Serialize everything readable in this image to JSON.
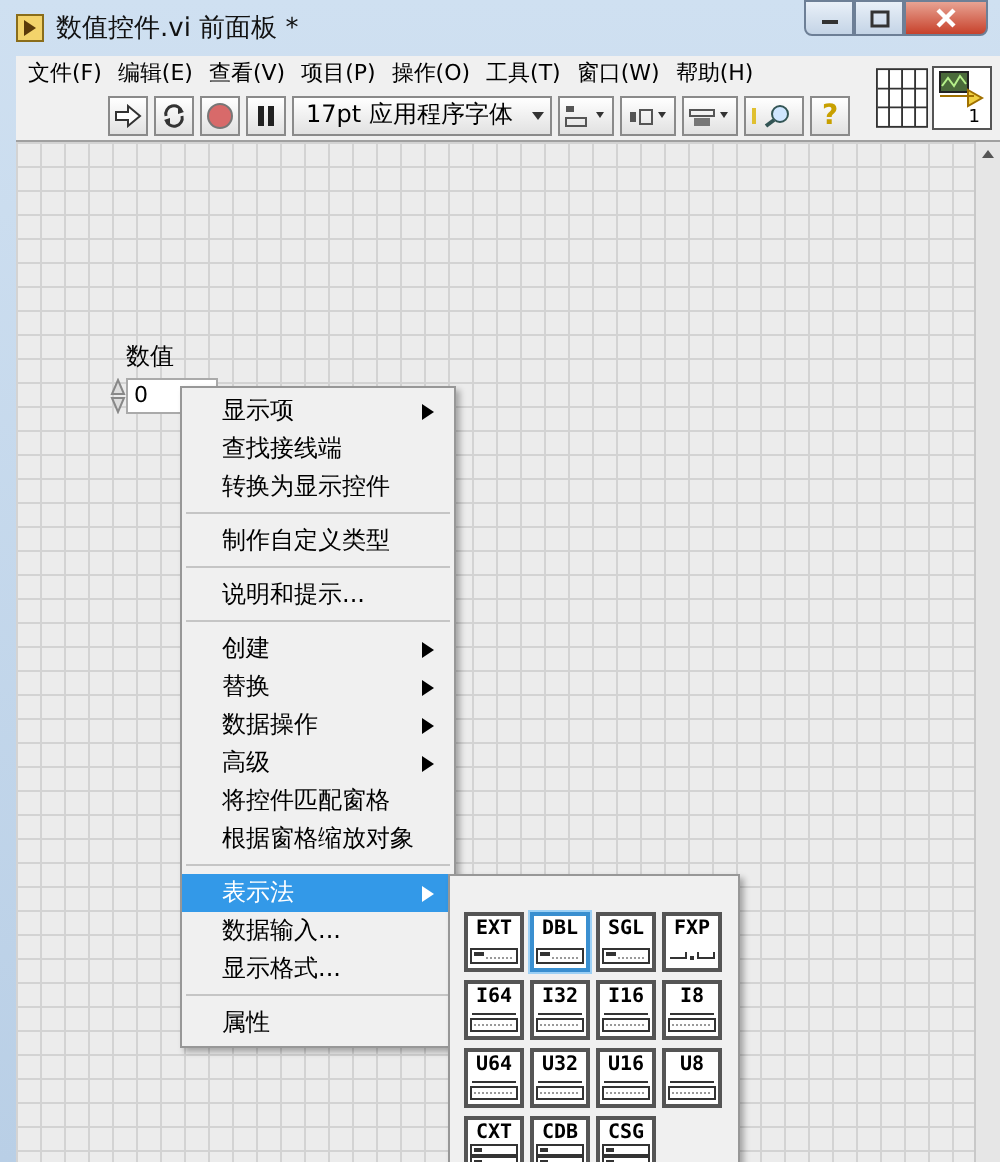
{
  "window": {
    "title": "数值控件.vi 前面板 *"
  },
  "menu_bar": {
    "items": [
      "文件(F)",
      "编辑(E)",
      "查看(V)",
      "项目(P)",
      "操作(O)",
      "工具(T)",
      "窗口(W)",
      "帮助(H)"
    ]
  },
  "toolbar": {
    "font": "17pt 应用程序字体",
    "help": "?"
  },
  "connector_pane": {
    "badge": "1"
  },
  "front_panel": {
    "control": {
      "label": "数值",
      "value": "0"
    }
  },
  "context_menu": {
    "items": [
      {
        "kind": "item",
        "label": "显示项",
        "submenu": true,
        "selected": false
      },
      {
        "kind": "item",
        "label": "查找接线端",
        "submenu": false,
        "selected": false
      },
      {
        "kind": "item",
        "label": "转换为显示控件",
        "submenu": false,
        "selected": false
      },
      {
        "kind": "separator"
      },
      {
        "kind": "item",
        "label": "制作自定义类型",
        "submenu": false,
        "selected": false
      },
      {
        "kind": "separator"
      },
      {
        "kind": "item",
        "label": "说明和提示...",
        "submenu": false,
        "selected": false
      },
      {
        "kind": "separator"
      },
      {
        "kind": "item",
        "label": "创建",
        "submenu": true,
        "selected": false
      },
      {
        "kind": "item",
        "label": "替换",
        "submenu": true,
        "selected": false
      },
      {
        "kind": "item",
        "label": "数据操作",
        "submenu": true,
        "selected": false
      },
      {
        "kind": "item",
        "label": "高级",
        "submenu": true,
        "selected": false
      },
      {
        "kind": "item",
        "label": "将控件匹配窗格",
        "submenu": false,
        "selected": false
      },
      {
        "kind": "item",
        "label": "根据窗格缩放对象",
        "submenu": false,
        "selected": false
      },
      {
        "kind": "separator"
      },
      {
        "kind": "item",
        "label": "表示法",
        "submenu": true,
        "selected": true
      },
      {
        "kind": "item",
        "label": "数据输入...",
        "submenu": false,
        "selected": false
      },
      {
        "kind": "item",
        "label": "显示格式...",
        "submenu": false,
        "selected": false
      },
      {
        "kind": "separator"
      },
      {
        "kind": "item",
        "label": "属性",
        "submenu": false,
        "selected": false
      }
    ]
  },
  "representation_palette": {
    "items": [
      {
        "label": "EXT",
        "kind": "float",
        "selected": false
      },
      {
        "label": "DBL",
        "kind": "float",
        "selected": true
      },
      {
        "label": "SGL",
        "kind": "float",
        "selected": false
      },
      {
        "label": "FXP",
        "kind": "fixed",
        "selected": false
      },
      {
        "label": "I64",
        "kind": "integer",
        "selected": false
      },
      {
        "label": "I32",
        "kind": "integer",
        "selected": false
      },
      {
        "label": "I16",
        "kind": "integer",
        "selected": false
      },
      {
        "label": "I8",
        "kind": "integer",
        "selected": false
      },
      {
        "label": "U64",
        "kind": "integer",
        "selected": false
      },
      {
        "label": "U32",
        "kind": "integer",
        "selected": false
      },
      {
        "label": "U16",
        "kind": "integer",
        "selected": false
      },
      {
        "label": "U8",
        "kind": "integer",
        "selected": false
      },
      {
        "label": "CXT",
        "kind": "complex",
        "selected": false
      },
      {
        "label": "CDB",
        "kind": "complex",
        "selected": false
      },
      {
        "label": "CSG",
        "kind": "complex",
        "selected": false
      }
    ]
  }
}
